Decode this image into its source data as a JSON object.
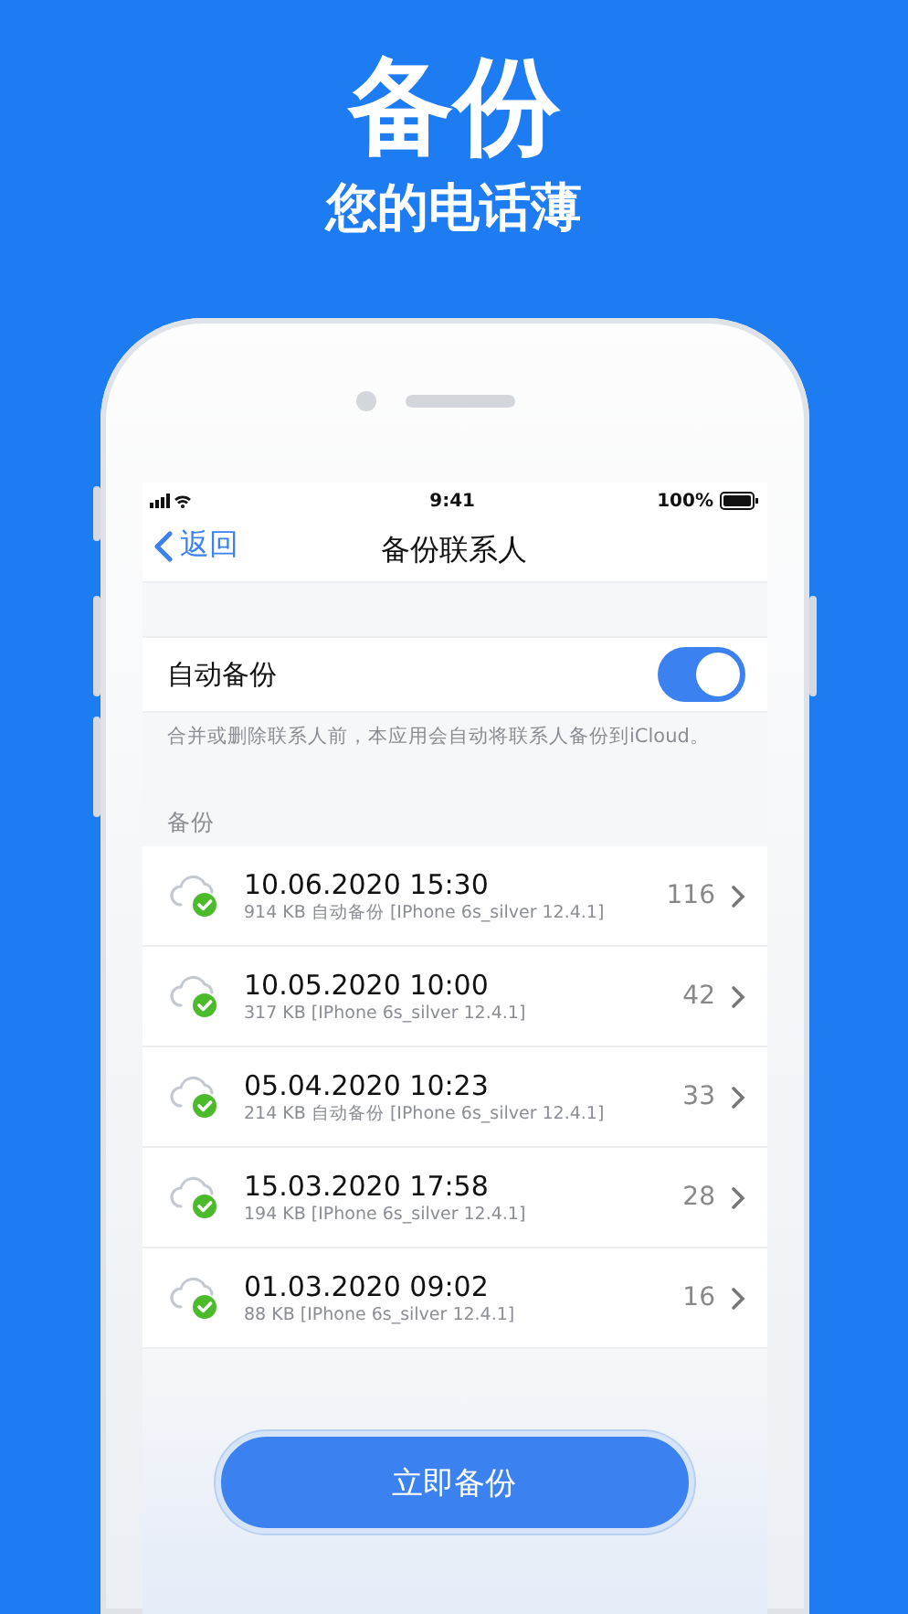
{
  "headline": "备份",
  "subheadline": "您的电话薄",
  "status_bar": {
    "time": "9:41",
    "battery": "100%"
  },
  "nav": {
    "back": "返回",
    "title": "备份联系人"
  },
  "auto_backup": {
    "label": "自动备份",
    "on": true,
    "description": "合并或删除联系人前，本应用会自动将联系人备份到iCloud。"
  },
  "section_label": "备份",
  "backups": [
    {
      "date": "10.06.2020 15:30",
      "details": "914 KB 自动备份 [IPhone 6s_silver 12.4.1]",
      "count": "116"
    },
    {
      "date": "10.05.2020 10:00",
      "details": "317 KB [IPhone 6s_silver 12.4.1]",
      "count": "42"
    },
    {
      "date": "05.04.2020 10:23",
      "details": "214 KB 自动备份 [IPhone 6s_silver 12.4.1]",
      "count": "33"
    },
    {
      "date": "15.03.2020 17:58",
      "details": "194 KB [IPhone 6s_silver 12.4.1]",
      "count": "28"
    },
    {
      "date": "01.03.2020 09:02",
      "details": "88 KB [IPhone 6s_silver 12.4.1]",
      "count": "16"
    }
  ],
  "backup_button": "立即备份"
}
